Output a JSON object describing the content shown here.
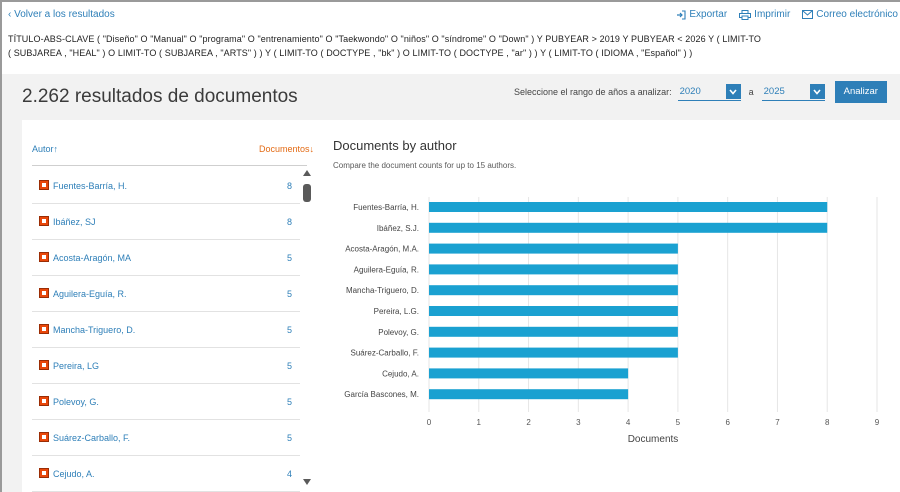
{
  "topbar": {
    "back_label": "Volver a los resultados",
    "export_label": "Exportar",
    "print_label": "Imprimir",
    "email_label": "Correo electrónico"
  },
  "query": {
    "line1": "TÍTULO-ABS-CLAVE ( \"Diseño\" O \"Manual\" O \"programa\" O \"entrenamiento\" O \"Taekwondo\" O \"niños\" O \"síndrome\" O \"Down\" ) Y PUBYEAR > 2019 Y PUBYEAR < 2026 Y ( LIMIT-TO",
    "line2": "( SUBJAREA , \"HEAL\" ) O LIMIT-TO ( SUBJAREA , \"ARTS\" ) ) Y ( LIMIT-TO ( DOCTYPE , \"bk\" ) O LIMIT-TO ( DOCTYPE , \"ar\" ) ) Y ( LIMIT-TO ( IDIOMA , \"Español\" ) )"
  },
  "results": {
    "title": "2.262 resultados de documentos"
  },
  "range": {
    "label": "Seleccione el rango de años a analizar:",
    "from": "2020",
    "separator": "a",
    "to": "2025",
    "analyze_label": "Analizar"
  },
  "list": {
    "author_header": "Autor",
    "author_arrow": "↑",
    "docs_header": "Documentos",
    "docs_arrow": "↓",
    "rows": [
      {
        "name": "Fuentes-Barría, H.",
        "count": "8"
      },
      {
        "name": "Ibáñez, SJ",
        "count": "8"
      },
      {
        "name": "Acosta-Aragón, MA",
        "count": "5"
      },
      {
        "name": "Aguilera-Eguía, R.",
        "count": "5"
      },
      {
        "name": "Mancha-Triguero, D.",
        "count": "5"
      },
      {
        "name": "Pereira, LG",
        "count": "5"
      },
      {
        "name": "Polevoy, G.",
        "count": "5"
      },
      {
        "name": "Suárez-Carballo, F.",
        "count": "5"
      },
      {
        "name": "Cejudo, A.",
        "count": "4"
      }
    ]
  },
  "chart_header": {
    "title": "Documents by author",
    "subtitle": "Compare the document counts for up to 15 authors."
  },
  "chart_data": {
    "type": "bar",
    "orientation": "horizontal",
    "categories": [
      "Fuentes-Barría, H.",
      "Ibáñez, S.J.",
      "Acosta-Aragón, M.A.",
      "Aguilera-Eguía, R.",
      "Mancha-Triguero, D.",
      "Pereira, L.G.",
      "Polevoy, G.",
      "Suárez-Carballo, F.",
      "Cejudo, A.",
      "García Bascones, M."
    ],
    "values": [
      8,
      8,
      5,
      5,
      5,
      5,
      5,
      5,
      4,
      4
    ],
    "xlabel": "Documents",
    "ylabel": "",
    "xlim": [
      0,
      9
    ],
    "xticks": [
      0,
      1,
      2,
      3,
      4,
      5,
      6,
      7,
      8,
      9
    ],
    "grid": true,
    "bar_color": "#1aa1d1"
  }
}
